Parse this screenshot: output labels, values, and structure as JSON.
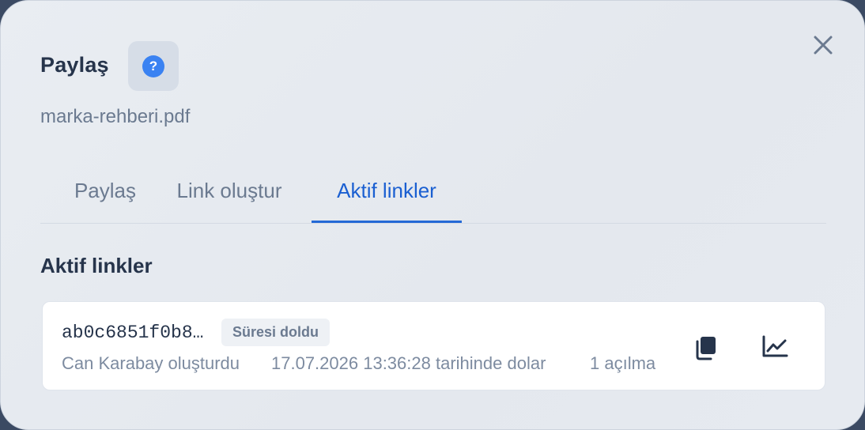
{
  "dialog": {
    "title": "Paylaş",
    "help_icon": "question-circle-icon",
    "help_glyph": "?",
    "close_icon": "close-icon",
    "filename": "marka-rehberi.pdf"
  },
  "tabs": [
    {
      "label": "Paylaş",
      "active": false
    },
    {
      "label": "Link oluştur",
      "active": false
    },
    {
      "label": "Aktif linkler",
      "active": true
    }
  ],
  "section": {
    "title": "Aktif linkler"
  },
  "links": [
    {
      "id": "ab0c6851f0b8…",
      "status": "Süresi doldu",
      "creator": "Can Karabay oluşturdu",
      "expiry": "17.07.2026 13:36:28 tarihinde dolar",
      "opens": "1 açılma",
      "copy_icon": "copy-icon",
      "stats_icon": "chart-line-icon"
    }
  ],
  "colors": {
    "accent": "#1a5fd1",
    "help_blue": "#3a82f2",
    "text_dark": "#26344b",
    "text_muted": "#6b7a90"
  }
}
